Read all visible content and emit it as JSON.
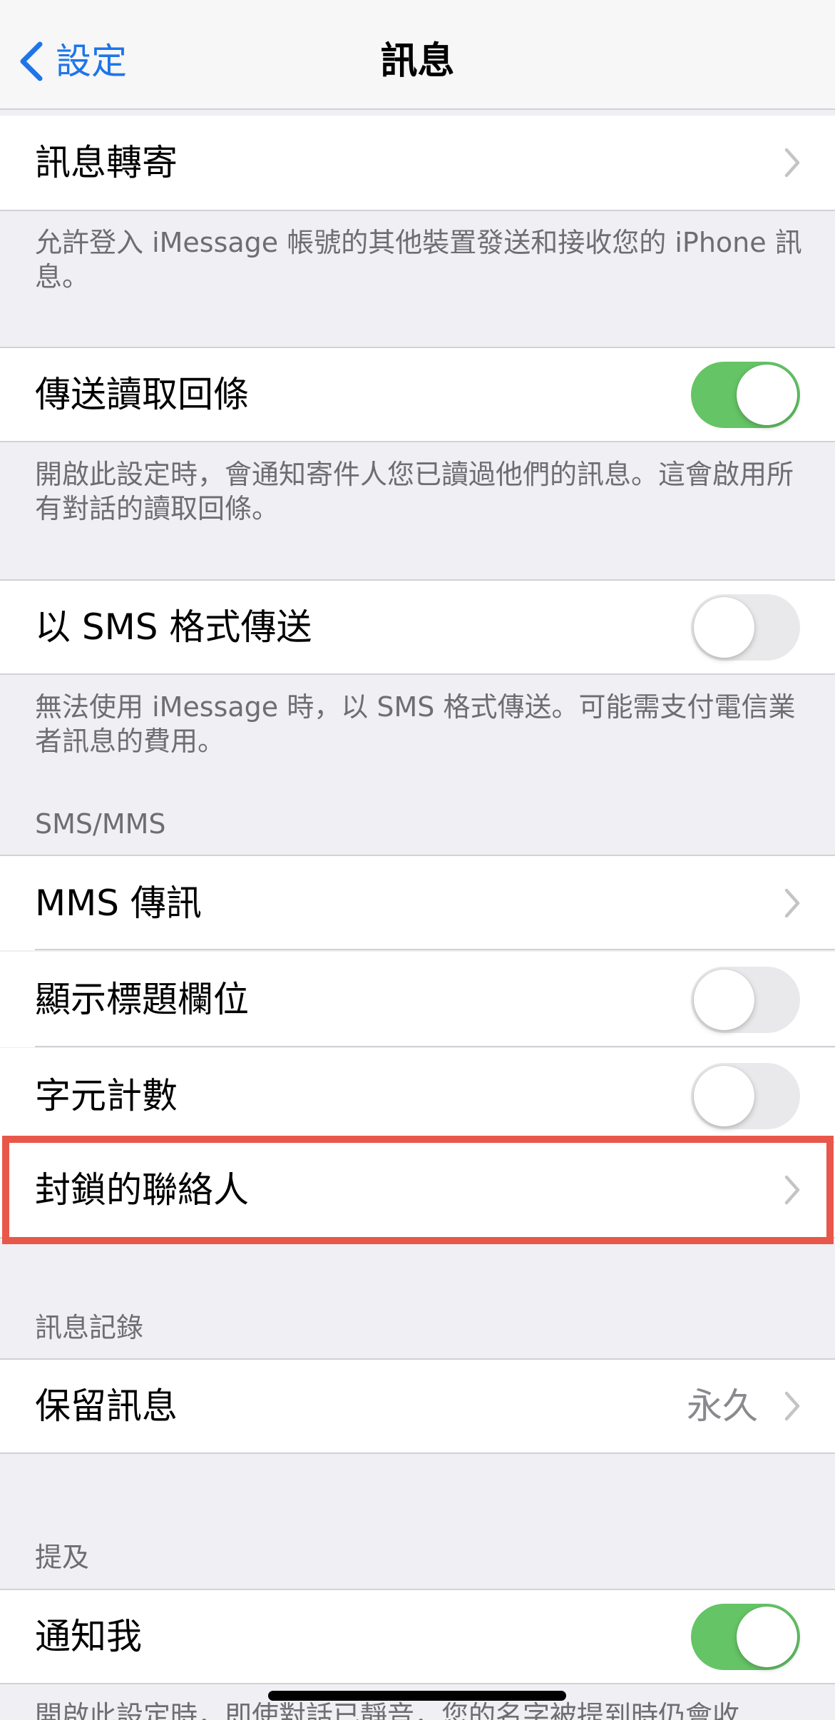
{
  "nav": {
    "back_label": "設定",
    "title": "訊息"
  },
  "sections": {
    "forwarding": {
      "label": "訊息轉寄",
      "note": "允許登入 iMessage 帳號的其他裝置發送和接收您的 iPhone 訊息。"
    },
    "read_receipts": {
      "label": "傳送讀取回條",
      "on": true,
      "note": "開啟此設定時，會通知寄件人您已讀過他們的訊息。這會啟用所有對話的讀取回條。"
    },
    "send_as_sms": {
      "label": "以 SMS 格式傳送",
      "on": false,
      "note": "無法使用 iMessage 時，以 SMS 格式傳送。可能需支付電信業者訊息的費用。"
    },
    "sms_mms": {
      "header": "SMS/MMS",
      "mms": {
        "label": "MMS 傳訊"
      },
      "subject": {
        "label": "顯示標題欄位",
        "on": false
      },
      "char_count": {
        "label": "字元計數",
        "on": false
      },
      "blocked": {
        "label": "封鎖的聯絡人"
      }
    },
    "history": {
      "header": "訊息記錄",
      "keep": {
        "label": "保留訊息",
        "value": "永久"
      }
    },
    "mentions": {
      "header": "提及",
      "notify": {
        "label": "通知我",
        "on": true
      },
      "note": "開啟此設定時，即使對話已靜音，您的名字被提到時仍會收"
    }
  },
  "colors": {
    "accent": "#1f75e8",
    "toggle_on": "#65c466",
    "highlight": "#e8574a"
  }
}
